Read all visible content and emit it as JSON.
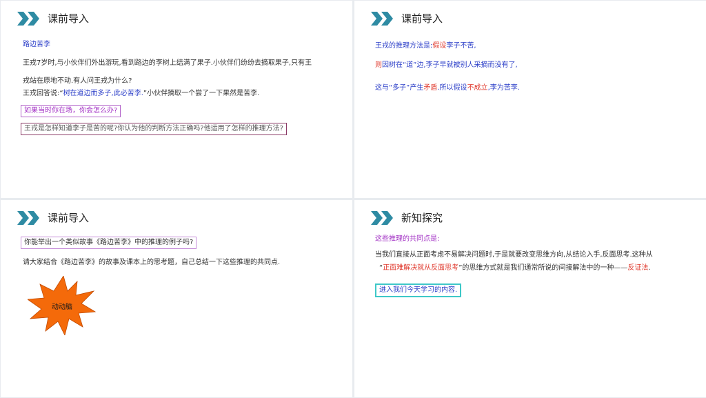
{
  "colors": {
    "accent_chevron": "#2e8ba3",
    "text_blue": "#2b3ec8",
    "text_red": "#e03a2e",
    "text_purple": "#a230c4",
    "burst_fill": "#f46a0a"
  },
  "slides": [
    {
      "title": "课前导入",
      "icon": "double-chevron-icon",
      "heading": "路边苦李",
      "p1": "王戎7岁时,与小伙伴们外出游玩,看到路边的李树上结满了果子.小伙伴们纷纷去摘取果子,只有王",
      "p2": "戎站在原地不动.有人问王戎为什么?",
      "p3_pre": "王戎回答说:“",
      "p3_quote": "树在道边而多子,此必苦李.",
      "p3_post": "”小伙伴摘取一个尝了一下果然是苦李.",
      "q1": "如果当时你在场，你会怎么办?",
      "q2": "王戎是怎样知道李子是苦的呢?你认为他的判断方法正确吗?他运用了怎样的推理方法?"
    },
    {
      "title": "课前导入",
      "icon": "double-chevron-icon",
      "l1_a": "王戎的推理方法是:",
      "l1_b": "假设",
      "l1_c": "李子不苦,",
      "l2_a": "则",
      "l2_b": "因树在“道”边,李子早就被别人采摘而没有了,",
      "l3_a": "这与“多子”产生",
      "l3_b": "矛盾",
      "l3_c": ".所以假设",
      "l3_d": "不成立",
      "l3_e": ",李为苦李."
    },
    {
      "title": "课前导入",
      "icon": "double-chevron-icon",
      "q": "你能举出一个类似故事《路边苦李》中的推理的例子吗?",
      "p": "请大家结合《路边苦李》的故事及课本上的思考题，自己总结一下这些推理的共同点.",
      "burst_label": "动动脑"
    },
    {
      "title": "新知探究",
      "icon": "double-chevron-icon",
      "h": "这些推理的共同点是:",
      "p1": "当我们直接从正面考虑不易解决问题时,于是就要改变思维方向,从结论入手,反面思考.这种从",
      "p2_a": "“",
      "p2_b": "正面难解决就从反面思考",
      "p2_c": "”的思维方式就是我们通常所说的间接解法中的一种——",
      "p2_d": "反证法",
      "p2_e": ".",
      "box": "进入我们今天学习的内容."
    }
  ]
}
